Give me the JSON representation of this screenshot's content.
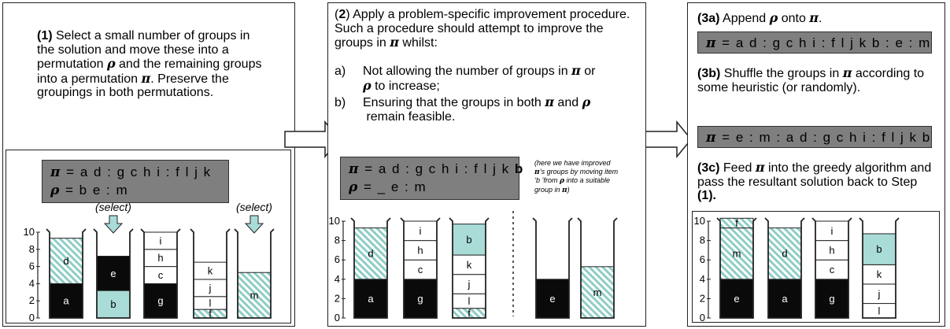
{
  "panel1": {
    "step": "(1)",
    "text_a": " Select a small number of groups in the solution and move these into a permutation ",
    "rho": "ρ",
    "text_b": " and the remaining groups into a permutation ",
    "pi": "π",
    "text_c": ". Preserve the groupings in both permutations.",
    "pi_line": " = a d : g c h i : f l j k",
    "rho_line": " = b e : m",
    "select_label_1": "(select)",
    "select_label_2": "(select)"
  },
  "panel2": {
    "step_open": "(",
    "step_num": "2",
    "step_close": ")",
    "intro": " Apply a problem-specific improvement procedure. Such a procedure should attempt to improve the groups in ",
    "pi": "π",
    "intro_end": " whilst:",
    "item_a_marker": "a)",
    "item_a_text": "Not allowing the number of groups in ",
    "item_a_or": " or ",
    "item_a_end": " to increase;",
    "item_b_marker": "b)",
    "item_b_text": "Ensuring that the groups in both ",
    "item_b_and": " and ",
    "item_b_end": " remain feasible.",
    "rho": "ρ",
    "pi_line": " = a d : g c h i : f l j k ",
    "pi_line_bold": "b",
    "rho_line": " = _ e : m",
    "note_1": "(here we have improved",
    "note_2": "’s groups by moving item",
    "note_3": "‘b ’from ",
    "note_4": " into a suitable",
    "note_5": "group in ",
    "note_6": ")"
  },
  "panel3": {
    "step_3a": "(3a)",
    "text_3a": " Append ",
    "onto": " onto ",
    "period": ".",
    "pi": "π",
    "rho": "ρ",
    "pi_line_3a": " = a d : g c h i : f l j k b : e : m",
    "step_3b": "(3b)",
    "text_3b_a": " Shuffle the groups in ",
    "text_3b_b": " according to some heuristic (or randomly).",
    "pi_line_3b": " = e : m : a d : g c h i : f l j k b",
    "step_3c": "(3c)",
    "text_3c_a": " Feed ",
    "text_3c_b": " into the greedy algorithm and pass the resultant solution back to Step ",
    "step_ref": "(1)."
  },
  "bins": {
    "axis_ticks": [
      "0",
      "2",
      "4",
      "6",
      "8",
      "10"
    ],
    "panel1": [
      {
        "items": [
          {
            "label": "a",
            "size": 4,
            "fill": "black"
          },
          {
            "label": "d",
            "size": 5.3,
            "fill": "hatch"
          }
        ]
      },
      {
        "items": [
          {
            "label": "b",
            "size": 3.2,
            "fill": "teal"
          },
          {
            "label": "e",
            "size": 4,
            "fill": "black"
          }
        ]
      },
      {
        "items": [
          {
            "label": "g",
            "size": 4,
            "fill": "black"
          },
          {
            "label": "c",
            "size": 2,
            "fill": "white"
          },
          {
            "label": "h",
            "size": 2,
            "fill": "white"
          },
          {
            "label": "i",
            "size": 2,
            "fill": "white"
          }
        ]
      },
      {
        "items": [
          {
            "label": "f",
            "size": 1,
            "fill": "hatch"
          },
          {
            "label": "l",
            "size": 1.5,
            "fill": "white"
          },
          {
            "label": "j",
            "size": 2,
            "fill": "white"
          },
          {
            "label": "k",
            "size": 2,
            "fill": "white"
          }
        ]
      },
      {
        "items": [
          {
            "label": "m",
            "size": 5.3,
            "fill": "hatch"
          }
        ]
      }
    ],
    "panel2": [
      {
        "items": [
          {
            "label": "a",
            "size": 4,
            "fill": "black"
          },
          {
            "label": "d",
            "size": 5.3,
            "fill": "hatch"
          }
        ]
      },
      {
        "items": [
          {
            "label": "g",
            "size": 4,
            "fill": "black"
          },
          {
            "label": "c",
            "size": 2,
            "fill": "white"
          },
          {
            "label": "h",
            "size": 2,
            "fill": "white"
          },
          {
            "label": "i",
            "size": 2,
            "fill": "white"
          }
        ]
      },
      {
        "items": [
          {
            "label": "f",
            "size": 1,
            "fill": "hatch"
          },
          {
            "label": "l",
            "size": 1.5,
            "fill": "white"
          },
          {
            "label": "j",
            "size": 2,
            "fill": "white"
          },
          {
            "label": "k",
            "size": 2,
            "fill": "white"
          },
          {
            "label": "b",
            "size": 3.2,
            "fill": "teal"
          }
        ]
      },
      {
        "items": [
          {
            "label": "e",
            "size": 4,
            "fill": "black"
          }
        ]
      },
      {
        "items": [
          {
            "label": "m",
            "size": 5.3,
            "fill": "hatch"
          }
        ]
      }
    ],
    "panel3": [
      {
        "items": [
          {
            "label": "e",
            "size": 4,
            "fill": "black"
          },
          {
            "label": "m",
            "size": 5.3,
            "fill": "hatch"
          },
          {
            "label": "f",
            "size": 1,
            "fill": "hatch"
          }
        ]
      },
      {
        "items": [
          {
            "label": "a",
            "size": 4,
            "fill": "black"
          },
          {
            "label": "d",
            "size": 5.3,
            "fill": "hatch"
          }
        ]
      },
      {
        "items": [
          {
            "label": "g",
            "size": 4,
            "fill": "black"
          },
          {
            "label": "c",
            "size": 2,
            "fill": "white"
          },
          {
            "label": "h",
            "size": 2,
            "fill": "white"
          },
          {
            "label": "i",
            "size": 2,
            "fill": "white"
          }
        ]
      },
      {
        "items": [
          {
            "label": "l",
            "size": 1.5,
            "fill": "white"
          },
          {
            "label": "j",
            "size": 2,
            "fill": "white"
          },
          {
            "label": "k",
            "size": 2,
            "fill": "white"
          },
          {
            "label": "b",
            "size": 3.2,
            "fill": "teal"
          }
        ]
      }
    ]
  },
  "colors": {
    "black": "#0a0a0a",
    "teal": "#a9dcd6",
    "hatch": "#8ecdc6",
    "grey": "#7f7f7f"
  }
}
